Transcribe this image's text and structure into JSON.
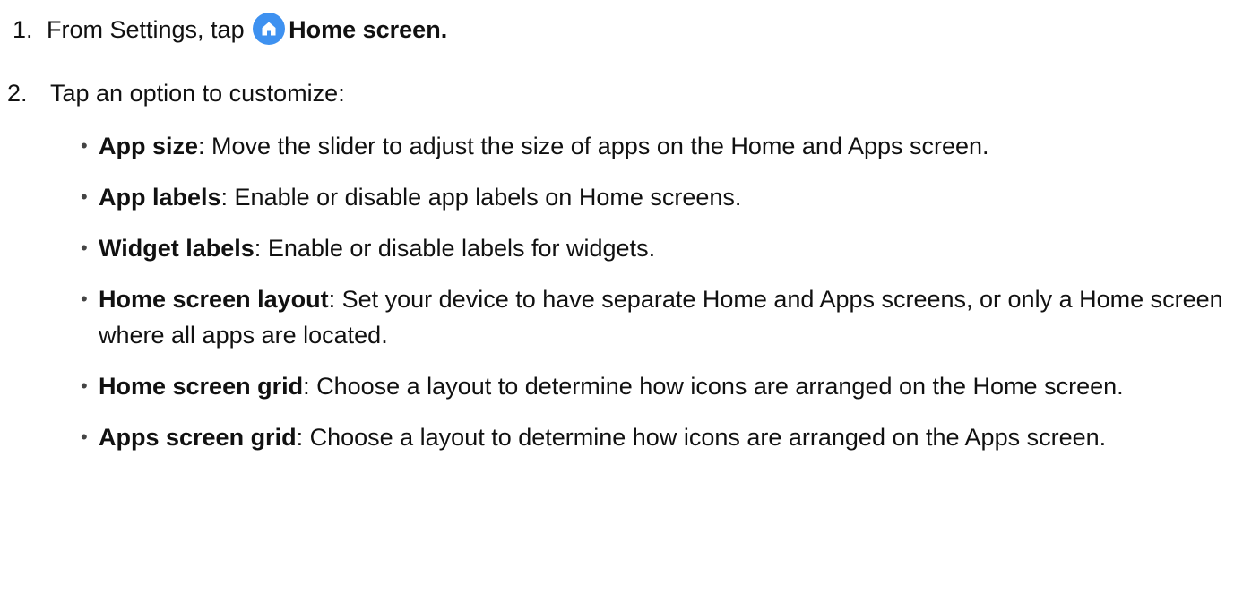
{
  "steps": [
    {
      "number": "1.",
      "text_before": "From Settings, tap",
      "icon": "home-icon",
      "bold_text": "Home screen."
    },
    {
      "number": "2.",
      "text": "Tap an option to customize:"
    }
  ],
  "options": [
    {
      "label": "App size",
      "separator": ":",
      "description": " Move the slider to adjust the size of apps on the Home and Apps screen."
    },
    {
      "label": "App labels",
      "separator": ":",
      "description": " Enable or disable app labels on Home screens."
    },
    {
      "label": "Widget labels",
      "separator": ":",
      "description": " Enable or disable labels for widgets."
    },
    {
      "label": "Home screen layout",
      "separator": ":",
      "description": " Set your device to have separate Home and Apps screens, or only a Home screen where all apps are located."
    },
    {
      "label": "Home screen grid",
      "separator": ":",
      "description": " Choose a layout to determine how icons are arranged on the Home screen."
    },
    {
      "label": "Apps screen grid",
      "separator": ":",
      "description": " Choose a layout to determine how icons are arranged on the Apps screen."
    }
  ],
  "colors": {
    "icon_background": "#3e91f0",
    "text": "#111111"
  }
}
